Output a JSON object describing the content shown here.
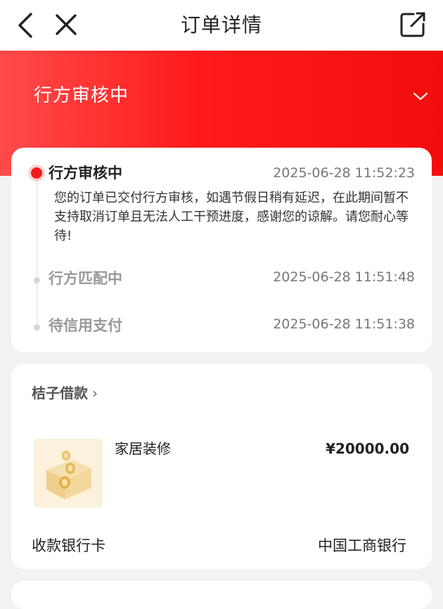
{
  "nav": {
    "title": "订单详情",
    "back_icon": "chevron-left-icon",
    "close_icon": "close-icon",
    "share_icon": "share-external-icon"
  },
  "banner": {
    "status": "行方审核中",
    "expand_icon": "chevron-down-icon",
    "colors": {
      "start": "#ff4a4a",
      "end": "#f30d0d"
    }
  },
  "timeline": [
    {
      "title": "行方审核中",
      "time": "2025-06-28 11:52:23",
      "description": "您的订单已交付行方审核，如遇节假日稍有延迟，在此期间暂不支持取消订单且无法人工干预进度，感谢您的谅解。请您耐心等待!",
      "active": true
    },
    {
      "title": "行方匹配中",
      "time": "2025-06-28 11:51:48",
      "active": false
    },
    {
      "title": "待信用支付",
      "time": "2025-06-28 11:51:38",
      "active": false
    }
  ],
  "loan": {
    "provider": "桔子借款",
    "provider_arrow": "›",
    "item_name": "家居装修",
    "amount": "¥20000.00",
    "bank_label": "收款银行卡",
    "bank_value": "中国工商银行"
  },
  "colors": {
    "accent": "#f21c1c",
    "page_bg": "#f2f2f2",
    "muted_text": "#777777"
  }
}
